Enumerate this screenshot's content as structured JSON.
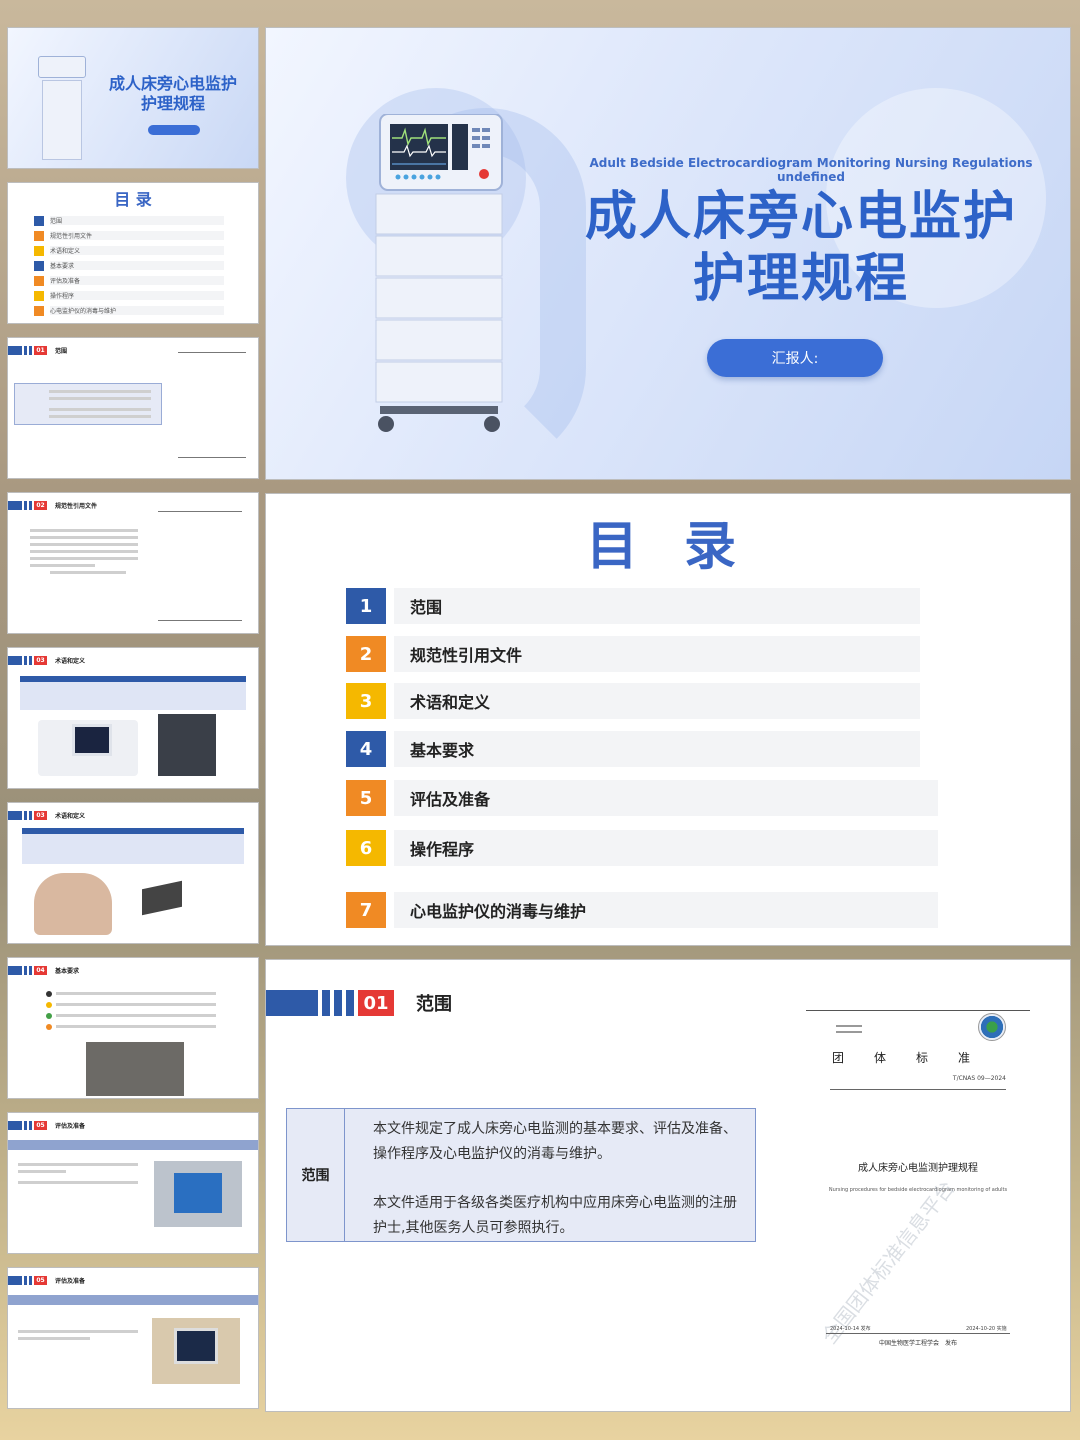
{
  "title_slide": {
    "en_title": "Adult Bedside Electrocardiogram Monitoring Nursing Regulations undefined",
    "cn_title_line1": "成人床旁心电监护",
    "cn_title_line2": "护理规程",
    "reporter_label": "汇报人:"
  },
  "toc_slide": {
    "title": "目 录",
    "items": [
      {
        "num": "1",
        "label": "范围",
        "color": "#2e5aa8"
      },
      {
        "num": "2",
        "label": "规范性引用文件",
        "color": "#f08a24"
      },
      {
        "num": "3",
        "label": "术语和定义",
        "color": "#f5b800"
      },
      {
        "num": "4",
        "label": "基本要求",
        "color": "#2e5aa8"
      },
      {
        "num": "5",
        "label": "评估及准备",
        "color": "#f08a24"
      },
      {
        "num": "6",
        "label": "操作程序",
        "color": "#f5b800"
      },
      {
        "num": "7",
        "label": "心电监护仪的消毒与维护",
        "color": "#f08a24"
      }
    ]
  },
  "scope_slide": {
    "section_num": "01",
    "section_title": "范围",
    "row_label": "范围",
    "para1": "本文件规定了成人床旁心电监测的基本要求、评估及准备、操作程序及心电监护仪的消毒与维护。",
    "para2": "本文件适用于各级各类医疗机构中应用床旁心电监测的注册护士,其他医务人员可参照执行。",
    "doc": {
      "standard_type": "团　　体　　标　　准",
      "code": "T/CNAS 09—2024",
      "cn_title": "成人床旁心电监测护理规程",
      "en_title": "Nursing procedures for bedside electrocardiogram monitoring of adults",
      "publish_date": "2024-10-14 发布",
      "implement_date": "2024-10-20 实施",
      "publisher": "中国生物医学工程学会　发布",
      "watermark": "全国团体标准信息平台"
    }
  },
  "thumbs": {
    "t1_title_line1": "成人床旁心电监护",
    "t1_title_line2": "护理规程",
    "t2_title": "目 录",
    "t2_items": [
      "范围",
      "规范性引用文件",
      "术语和定义",
      "基本要求",
      "评估及准备",
      "操作程序",
      "心电监护仪的消毒与维护"
    ],
    "t3_num": "01",
    "t3_title": "范围",
    "t4_num": "02",
    "t4_title": "规范性引用文件",
    "t5_num": "03",
    "t5_title": "术语和定义",
    "t6_num": "03",
    "t6_title": "术语和定义",
    "t7_num": "04",
    "t7_title": "基本要求",
    "t8_num": "05",
    "t8_title": "评估及准备",
    "t9_num": "05",
    "t9_title": "评估及准备"
  }
}
